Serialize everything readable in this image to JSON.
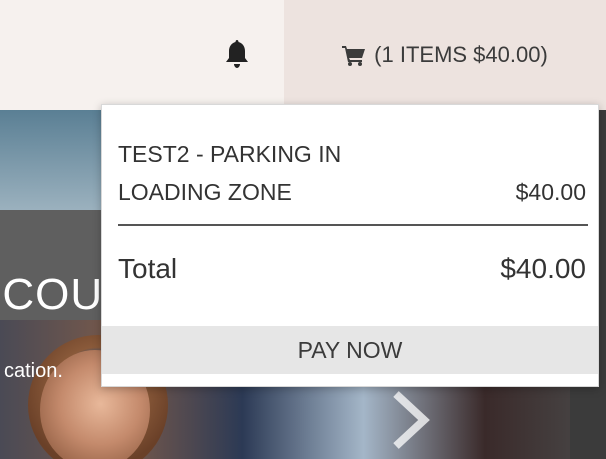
{
  "header": {
    "bell_icon": "bell-icon",
    "cart_icon": "cart-icon",
    "cart_summary": "(1 ITEMS $40.00)"
  },
  "hero": {
    "headline_fragment": "ECOU",
    "subtext_fragment": "cation.",
    "next_icon": "chevron-right-icon"
  },
  "cart_dropdown": {
    "items": [
      {
        "name": "TEST2 - PARKING IN LOADING ZONE",
        "price": "$40.00"
      }
    ],
    "total_label": "Total",
    "total_value": "$40.00",
    "pay_label": "PAY NOW"
  },
  "colors": {
    "header_bg": "#f6f1ee",
    "cart_button_bg": "#ede3df",
    "pay_button_bg": "#e6e6e6",
    "text": "#333333"
  }
}
